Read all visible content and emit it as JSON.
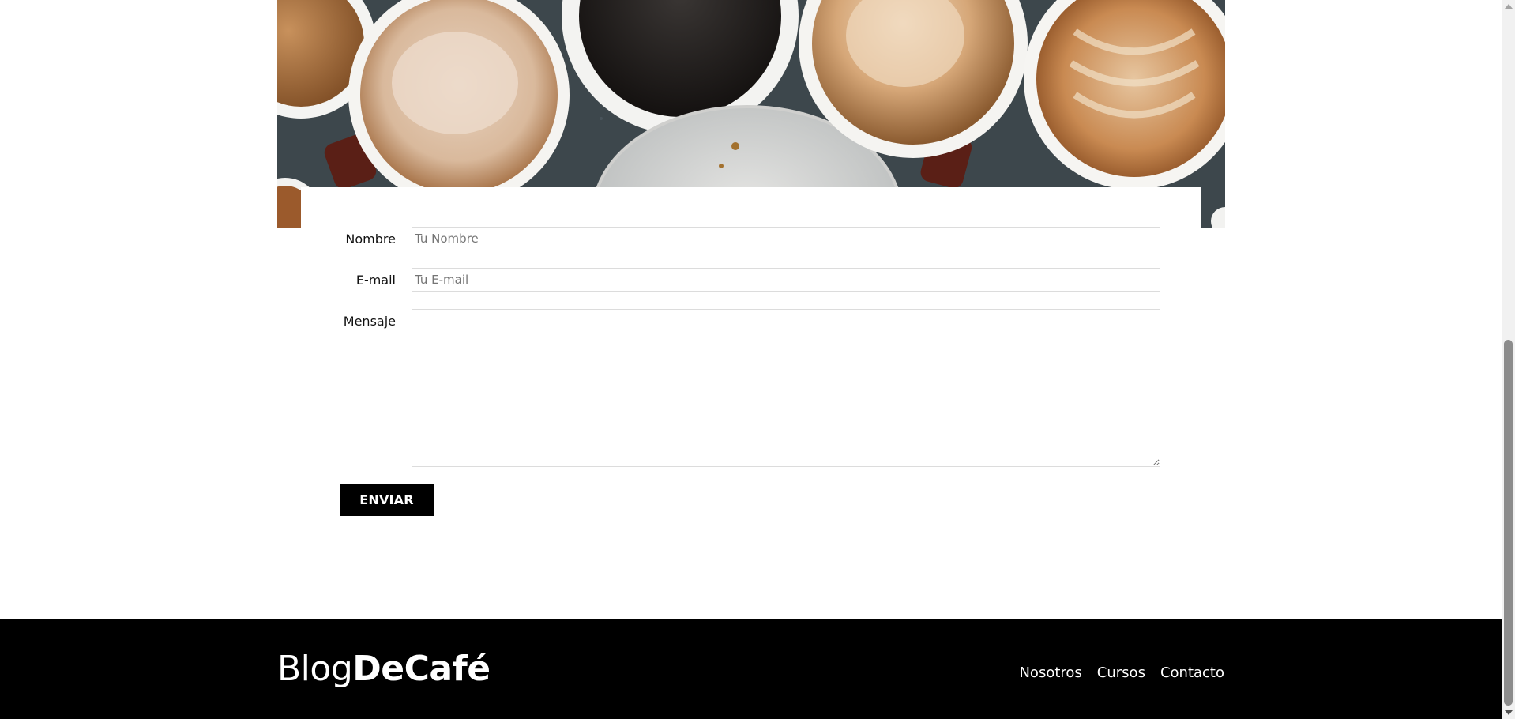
{
  "hero": {
    "image": "coffee-cups-top-view"
  },
  "form": {
    "name_label": "Nombre",
    "name_placeholder": "Tu Nombre",
    "name_value": "",
    "email_label": "E-mail",
    "email_placeholder": "Tu E-mail",
    "email_value": "",
    "message_label": "Mensaje",
    "message_value": "",
    "submit_label": "ENVIAR"
  },
  "footer": {
    "logo_light": "Blog",
    "logo_bold": "DeCafé",
    "nav": [
      {
        "label": "Nosotros"
      },
      {
        "label": "Cursos"
      },
      {
        "label": "Contacto"
      }
    ]
  },
  "colors": {
    "footer_background": "#000000",
    "button_background": "#000000",
    "button_text": "#ffffff",
    "input_border": "#dcdcdc"
  }
}
